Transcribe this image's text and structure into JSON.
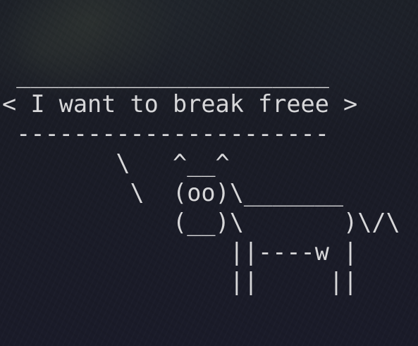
{
  "terminal": {
    "lines": [
      " ______________________",
      "< I want to break freee >",
      " ----------------------",
      "        \\   ^__^",
      "         \\  (oo)\\_______",
      "            (__)\\       )\\/\\",
      "                ||----w |",
      "                ||     ||"
    ],
    "text_color": "#d7d7d9",
    "background_color": "#1b1d2a"
  }
}
